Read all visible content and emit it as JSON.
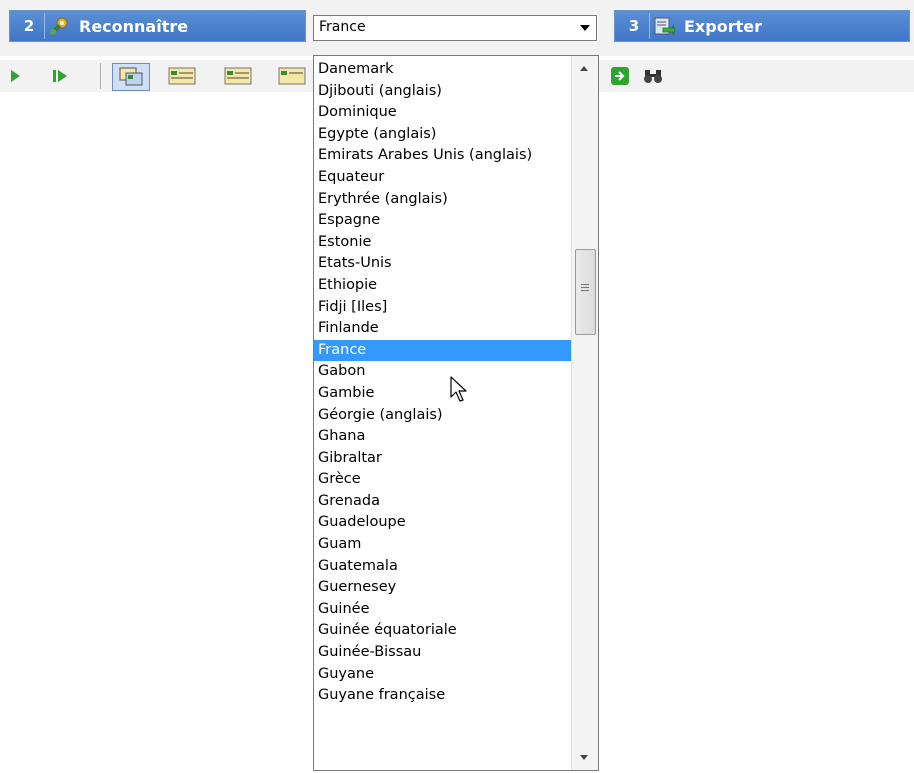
{
  "header": {
    "step2": {
      "number": "2",
      "label": "Reconnaître",
      "icon": "gear-wand-icon"
    },
    "step3": {
      "number": "3",
      "label": "Exporter",
      "icon": "export-icon"
    }
  },
  "language_select": {
    "selected": "France",
    "options": [
      "Danemark",
      "Djibouti (anglais)",
      "Dominique",
      "Egypte (anglais)",
      "Emirats Arabes Unis (anglais)",
      "Equateur",
      "Erythrée (anglais)",
      "Espagne",
      "Estonie",
      "Etats-Unis",
      "Ethiopie",
      "Fidji [Iles]",
      "Finlande",
      "France",
      "Gabon",
      "Gambie",
      "Géorgie (anglais)",
      "Ghana",
      "Gibraltar",
      "Grèce",
      "Grenada",
      "Guadeloupe",
      "Guam",
      "Guatemala",
      "Guernesey",
      "Guinée",
      "Guinée équatoriale",
      "Guinée-Bissau",
      "Guyane",
      "Guyane française"
    ],
    "selected_index": 13
  },
  "toolbar": {
    "icons": [
      "play-icon",
      "play-next-icon",
      "layout-icon",
      "form-icon",
      "form-icon",
      "form-icon",
      "next-arrow-icon",
      "binoculars-icon"
    ]
  },
  "colors": {
    "header_blue": "#4a82cf",
    "selection": "#3399ff"
  }
}
